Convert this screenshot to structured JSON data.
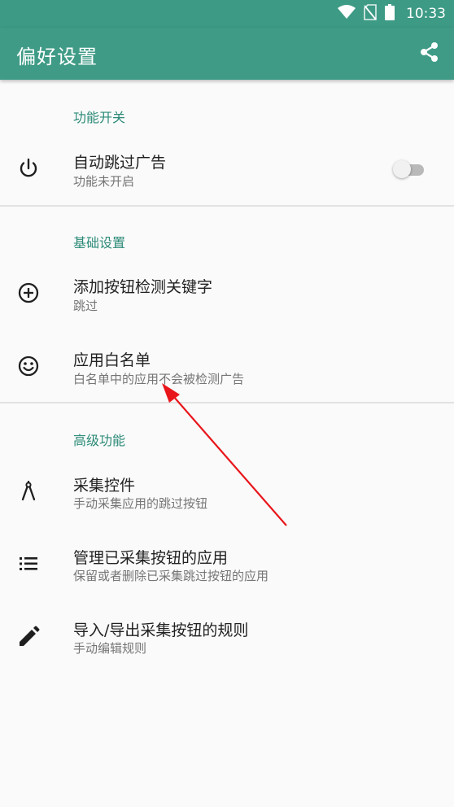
{
  "status_bar": {
    "time": "10:33",
    "icons": [
      "wifi-icon",
      "no-sim-icon",
      "battery-icon"
    ]
  },
  "app_bar": {
    "title": "偏好设置",
    "share_icon": "share-icon"
  },
  "sections": [
    {
      "title": "功能开关",
      "items": [
        {
          "icon": "power-icon",
          "title": "自动跳过广告",
          "subtitle": "功能未开启",
          "toggle": false
        }
      ]
    },
    {
      "title": "基础设置",
      "items": [
        {
          "icon": "add-circle-icon",
          "title": "添加按钮检测关键字",
          "subtitle": "跳过"
        },
        {
          "icon": "smiley-icon",
          "title": "应用白名单",
          "subtitle": "白名单中的应用不会被检测广告"
        }
      ]
    },
    {
      "title": "高级功能",
      "items": [
        {
          "icon": "compass-icon",
          "title": "采集控件",
          "subtitle": "手动采集应用的跳过按钮"
        },
        {
          "icon": "list-icon",
          "title": "管理已采集按钮的应用",
          "subtitle": "保留或者删除已采集跳过按钮的应用"
        },
        {
          "icon": "edit-icon",
          "title": "导入/导出采集按钮的规则",
          "subtitle": "手动编辑规则"
        }
      ]
    }
  ],
  "colors": {
    "primary": "#3f9b86",
    "accent_text": "#2b8a77",
    "annotation_arrow": "#e8161b"
  }
}
